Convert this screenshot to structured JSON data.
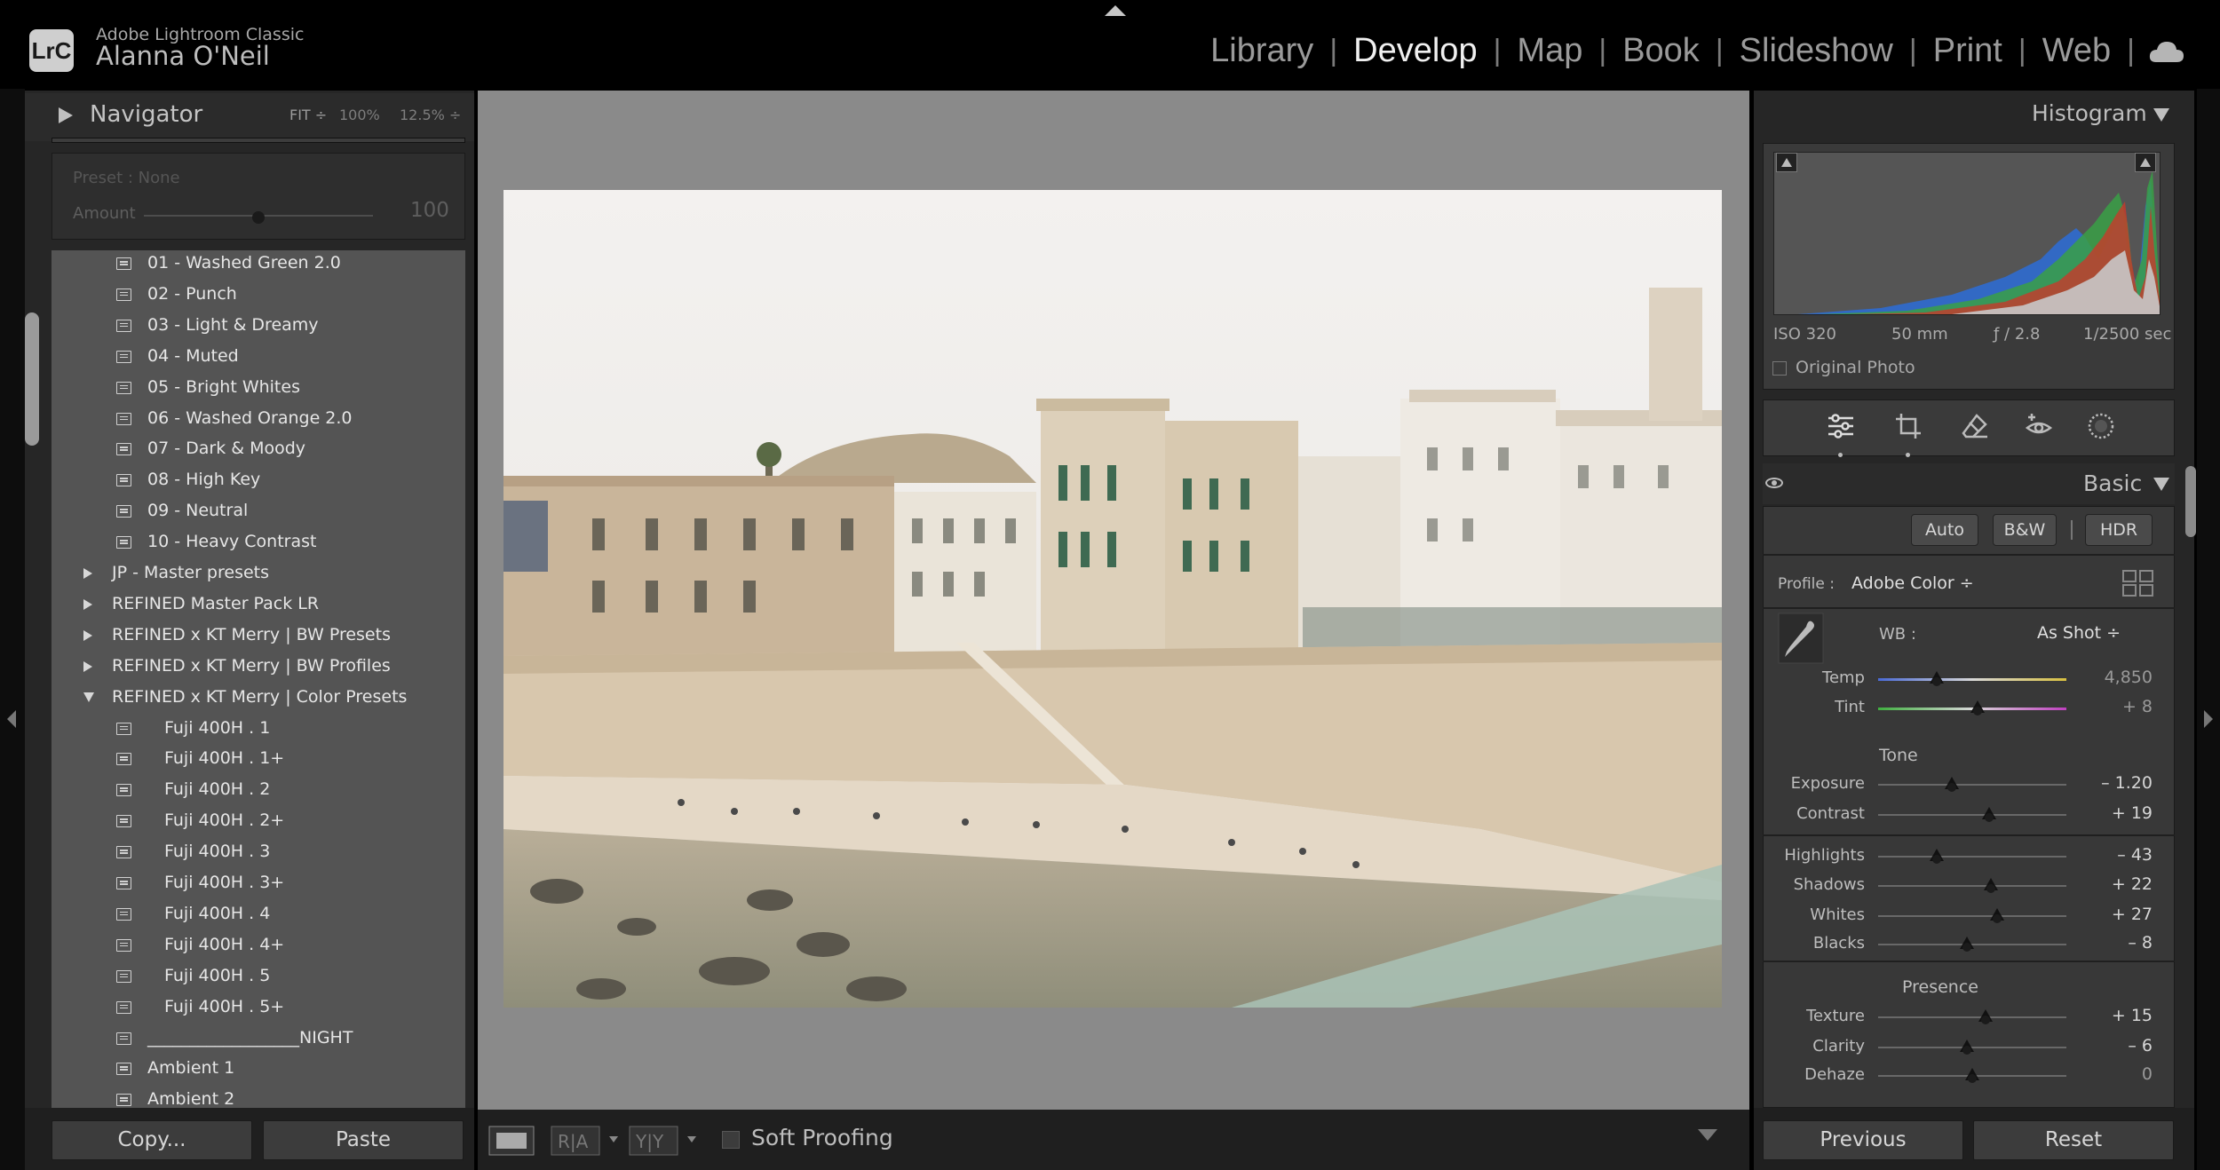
{
  "app": {
    "name": "Adobe Lightroom Classic",
    "user": "Alanna O'Neil",
    "logo": "LrC"
  },
  "modules": [
    "Library",
    "Develop",
    "Map",
    "Book",
    "Slideshow",
    "Print",
    "Web"
  ],
  "active_module": "Develop",
  "navigator": {
    "title": "Navigator",
    "fit": "FIT ÷",
    "zoom1": "100%",
    "zoom2": "12.5% ÷"
  },
  "preset_preview": {
    "preset": "Preset : None",
    "amount_label": "Amount",
    "amount_value": "100",
    "amount_level": 1.0
  },
  "preset_list": [
    {
      "type": "preset",
      "label": "01 - Washed Green 2.0",
      "indent": 1
    },
    {
      "type": "preset",
      "label": "02 - Punch",
      "indent": 1
    },
    {
      "type": "preset",
      "label": "03 - Light & Dreamy",
      "indent": 1
    },
    {
      "type": "preset",
      "label": "04 - Muted",
      "indent": 1
    },
    {
      "type": "preset",
      "label": "05 - Bright Whites",
      "indent": 1
    },
    {
      "type": "preset",
      "label": "06 - Washed Orange 2.0",
      "indent": 1
    },
    {
      "type": "preset",
      "label": "07 - Dark & Moody",
      "indent": 1
    },
    {
      "type": "preset",
      "label": "08 - High Key",
      "indent": 1
    },
    {
      "type": "preset",
      "label": "09 - Neutral",
      "indent": 1
    },
    {
      "type": "preset",
      "label": "10 - Heavy Contrast",
      "indent": 1
    },
    {
      "type": "folder",
      "label": "JP - Master presets",
      "open": false
    },
    {
      "type": "folder",
      "label": "REFINED Master Pack LR",
      "open": false
    },
    {
      "type": "folder",
      "label": "REFINED x KT Merry | BW Presets",
      "open": false
    },
    {
      "type": "folder",
      "label": "REFINED x KT Merry | BW Profiles",
      "open": false
    },
    {
      "type": "folder",
      "label": "REFINED x KT Merry | Color Presets",
      "open": true
    },
    {
      "type": "preset",
      "label": "Fuji 400H . 1",
      "indent": 2
    },
    {
      "type": "preset",
      "label": "Fuji 400H . 1+",
      "indent": 2
    },
    {
      "type": "preset",
      "label": "Fuji 400H . 2",
      "indent": 2
    },
    {
      "type": "preset",
      "label": "Fuji 400H . 2+",
      "indent": 2
    },
    {
      "type": "preset",
      "label": "Fuji 400H . 3",
      "indent": 2
    },
    {
      "type": "preset",
      "label": "Fuji 400H . 3+",
      "indent": 2
    },
    {
      "type": "preset",
      "label": "Fuji 400H . 4",
      "indent": 2
    },
    {
      "type": "preset",
      "label": "Fuji 400H . 4+",
      "indent": 2
    },
    {
      "type": "preset",
      "label": "Fuji 400H . 5",
      "indent": 2
    },
    {
      "type": "preset",
      "label": "Fuji 400H . 5+",
      "indent": 2
    },
    {
      "type": "preset",
      "label": "__________________NIGHT",
      "indent": 1
    },
    {
      "type": "preset",
      "label": "Ambient 1",
      "indent": 1
    },
    {
      "type": "preset",
      "label": "Ambient 2",
      "indent": 1
    }
  ],
  "left_buttons": {
    "copy": "Copy...",
    "paste": "Paste"
  },
  "toolbar": {
    "soft_proofing": "Soft Proofing"
  },
  "histogram": {
    "title": "Histogram",
    "iso": "ISO 320",
    "focal": "50 mm",
    "aperture": "ƒ / 2.8",
    "shutter": "1/2500 sec",
    "original_photo": "Original Photo"
  },
  "basic": {
    "title": "Basic",
    "buttons": {
      "auto": "Auto",
      "bw": "B&W",
      "hdr": "HDR"
    },
    "profile_label": "Profile :",
    "profile_value": "Adobe Color ÷",
    "wb_label": "WB :",
    "wb_value": "As Shot ÷",
    "tone_label": "Tone",
    "presence_label": "Presence",
    "sliders": [
      {
        "name": "Temp",
        "value": "4,850",
        "pos": 0.31
      },
      {
        "name": "Tint",
        "value": "+ 8",
        "pos": 0.53
      },
      {
        "name": "Exposure",
        "value": "– 1.20",
        "pos": 0.39
      },
      {
        "name": "Contrast",
        "value": "+ 19",
        "pos": 0.59
      },
      {
        "name": "Highlights",
        "value": "– 43",
        "pos": 0.31
      },
      {
        "name": "Shadows",
        "value": "+ 22",
        "pos": 0.6
      },
      {
        "name": "Whites",
        "value": "+ 27",
        "pos": 0.63
      },
      {
        "name": "Blacks",
        "value": "– 8",
        "pos": 0.47
      },
      {
        "name": "Texture",
        "value": "+ 15",
        "pos": 0.57
      },
      {
        "name": "Clarity",
        "value": "– 6",
        "pos": 0.47
      },
      {
        "name": "Dehaze",
        "value": "0",
        "pos": 0.5
      }
    ]
  },
  "right_buttons": {
    "previous": "Previous",
    "reset": "Reset"
  }
}
